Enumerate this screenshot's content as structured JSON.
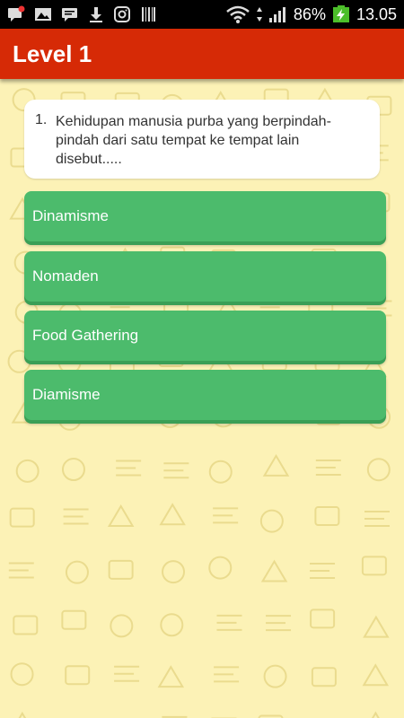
{
  "status_bar": {
    "battery_percent": "86%",
    "time": "13.05",
    "notification_icons": [
      "chat-alert-icon",
      "image-icon",
      "chat-icon",
      "download-icon",
      "instagram-icon",
      "barcode-icon"
    ],
    "system_icons": [
      "wifi-icon",
      "signal-icon",
      "battery-charging-icon"
    ]
  },
  "appbar": {
    "title": "Level 1",
    "color": "#d62a06"
  },
  "question": {
    "number": "1.",
    "text": "Kehidupan manusia purba yang berpindah-pindah dari satu tempat ke tempat lain disebut....."
  },
  "answers": [
    {
      "label": "Dinamisme"
    },
    {
      "label": "Nomaden"
    },
    {
      "label": "Food Gathering"
    },
    {
      "label": "Diamisme"
    }
  ],
  "colors": {
    "answer": "#4cbb6c",
    "background": "#fcf2b6"
  }
}
